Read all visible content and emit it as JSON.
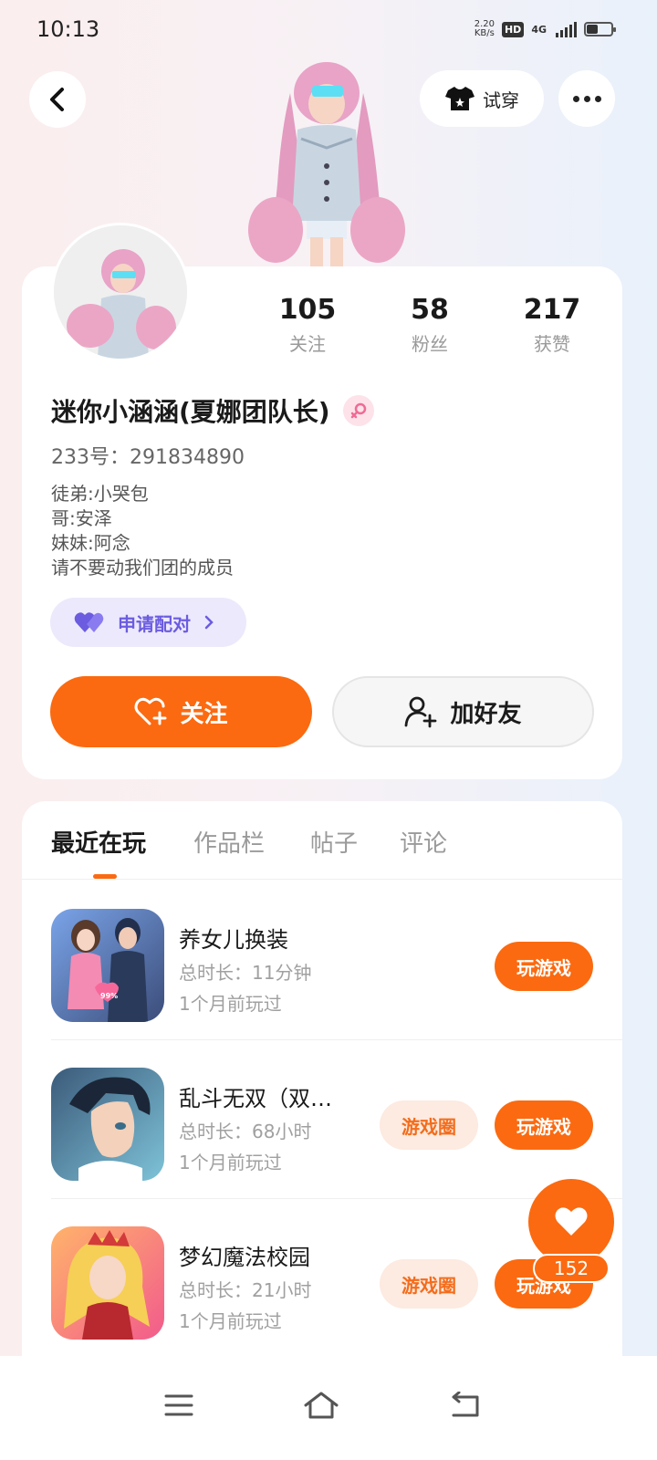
{
  "status_bar": {
    "time": "10:13",
    "net_speed_value": "2.20",
    "net_speed_unit": "KB/s",
    "hd_label": "HD",
    "network_label": "4G"
  },
  "header": {
    "try_on_label": "试穿"
  },
  "profile": {
    "stats": [
      {
        "value": "105",
        "label": "关注"
      },
      {
        "value": "58",
        "label": "粉丝"
      },
      {
        "value": "217",
        "label": "获赞"
      }
    ],
    "nickname": "迷你小涵涵(夏娜团队长)",
    "uid": "233号：291834890",
    "bio_lines": [
      "徒弟:小哭包",
      "哥:安泽",
      "妹妹:阿念",
      "请不要动我们团的成员"
    ],
    "pair_label": "申请配对",
    "follow_label": "关注",
    "add_friend_label": "加好友"
  },
  "tabs": [
    "最近在玩",
    "作品栏",
    "帖子",
    "评论"
  ],
  "games": [
    {
      "title": "养女儿换装",
      "time": "总时长：11分钟",
      "last": "1个月前玩过",
      "play_label": "玩游戏",
      "badge": "99%"
    },
    {
      "title": "乱斗无双（双…",
      "time": "总时长：68小时",
      "last": "1个月前玩过",
      "play_label": "玩游戏",
      "circle_label": "游戏圈"
    },
    {
      "title": "梦幻魔法校园",
      "time": "总时长：21小时",
      "last": "1个月前玩过",
      "play_label": "玩游戏",
      "circle_label": "游戏圈"
    }
  ],
  "likes": {
    "count": "152"
  },
  "colors": {
    "accent": "#fb6a10",
    "pair_purple": "#6b5ce0",
    "circle_bg": "#fdeae0"
  },
  "icons": [
    "back-arrow-icon",
    "tshirt-icon",
    "more-dots-icon",
    "female-icon",
    "double-heart-icon",
    "heart-plus-icon",
    "add-user-icon",
    "chevron-right-icon",
    "heart-icon",
    "menu-icon",
    "home-icon",
    "return-icon"
  ]
}
